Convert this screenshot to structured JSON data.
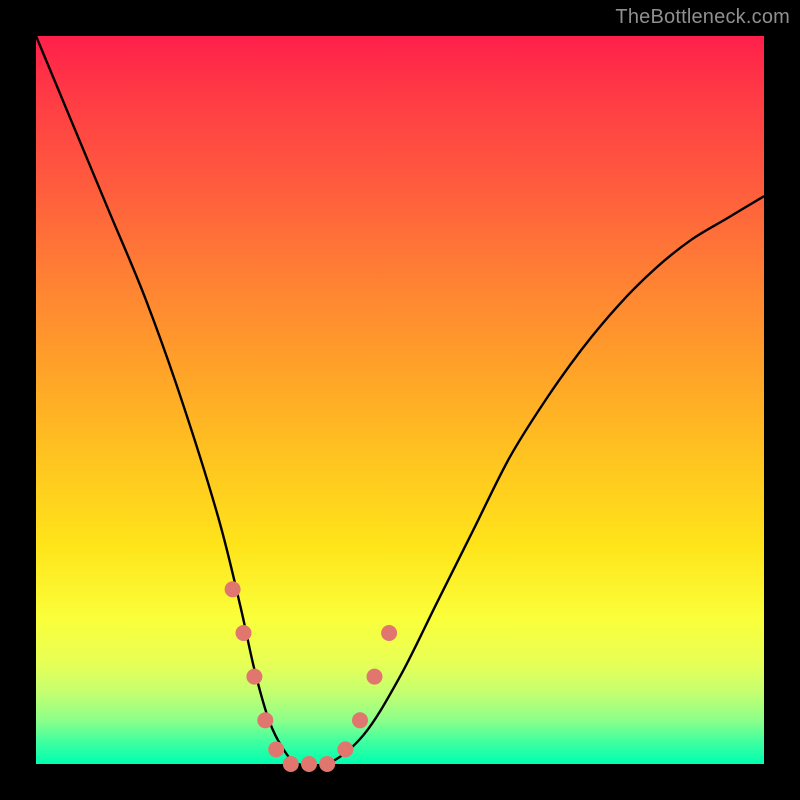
{
  "watermark": "TheBottleneck.com",
  "colors": {
    "frame": "#000000",
    "gradient_top": "#ff1f4b",
    "gradient_bottom": "#00ffb0",
    "curve": "#000000",
    "marker": "#e0766e"
  },
  "chart_data": {
    "type": "line",
    "title": "",
    "xlabel": "",
    "ylabel": "",
    "xlim": [
      0,
      100
    ],
    "ylim": [
      0,
      100
    ],
    "series": [
      {
        "name": "bottleneck-curve",
        "x": [
          0,
          5,
          10,
          15,
          20,
          25,
          28,
          30,
          32,
          34,
          36,
          40,
          45,
          50,
          55,
          60,
          65,
          70,
          75,
          80,
          85,
          90,
          95,
          100
        ],
        "values": [
          100,
          88,
          76,
          64,
          50,
          34,
          22,
          13,
          6,
          2,
          0,
          0,
          4,
          12,
          22,
          32,
          42,
          50,
          57,
          63,
          68,
          72,
          75,
          78
        ]
      }
    ],
    "markers": [
      {
        "x": 27.0,
        "y": 24
      },
      {
        "x": 28.5,
        "y": 18
      },
      {
        "x": 30.0,
        "y": 12
      },
      {
        "x": 31.5,
        "y": 6
      },
      {
        "x": 33.0,
        "y": 2
      },
      {
        "x": 35.0,
        "y": 0
      },
      {
        "x": 37.5,
        "y": 0
      },
      {
        "x": 40.0,
        "y": 0
      },
      {
        "x": 42.5,
        "y": 2
      },
      {
        "x": 44.5,
        "y": 6
      },
      {
        "x": 46.5,
        "y": 12
      },
      {
        "x": 48.5,
        "y": 18
      }
    ],
    "marker_radius_px": 8
  }
}
